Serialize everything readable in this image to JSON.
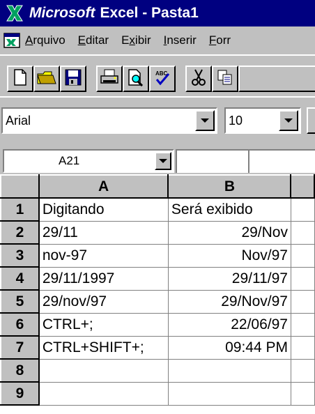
{
  "window": {
    "brand": "Microsoft",
    "title_rest": "Excel - Pasta1",
    "titlebar_color": "#000080"
  },
  "menu": {
    "items": [
      {
        "ul": "A",
        "rest": "rquivo"
      },
      {
        "ul": "E",
        "rest": "ditar"
      },
      {
        "pre": "E",
        "ul": "x",
        "rest": "ibir"
      },
      {
        "ul": "I",
        "rest": "nserir"
      },
      {
        "ul": "F",
        "rest": "orr"
      }
    ]
  },
  "toolbar": {
    "icons": [
      "new-file-icon",
      "open-folder-icon",
      "save-disk-icon",
      "print-icon",
      "print-preview-icon",
      "spell-check-icon",
      "cut-icon",
      "copy-icon"
    ],
    "spell_text": "ABC"
  },
  "format": {
    "font": "Arial",
    "size": "10"
  },
  "namebox": {
    "value": "A21"
  },
  "sheet": {
    "columns": [
      "A",
      "B"
    ],
    "rows": [
      {
        "num": "1",
        "a": "Digitando",
        "b": "Será exibido",
        "b_align": "left"
      },
      {
        "num": "2",
        "a": "29/11",
        "b": "29/Nov",
        "b_align": "right"
      },
      {
        "num": "3",
        "a": "nov-97",
        "b": "Nov/97",
        "b_align": "right"
      },
      {
        "num": "4",
        "a": "29/11/1997",
        "b": "29/11/97",
        "b_align": "right"
      },
      {
        "num": "5",
        "a": "29/nov/97",
        "b": "29/Nov/97",
        "b_align": "right"
      },
      {
        "num": "6",
        "a": "CTRL+;",
        "b": "22/06/97",
        "b_align": "right"
      },
      {
        "num": "7",
        "a": "CTRL+SHIFT+;",
        "b": "09:44 PM",
        "b_align": "right"
      },
      {
        "num": "8",
        "a": "",
        "b": "",
        "b_align": "right"
      },
      {
        "num": "9",
        "a": "",
        "b": "",
        "b_align": "right"
      }
    ]
  }
}
